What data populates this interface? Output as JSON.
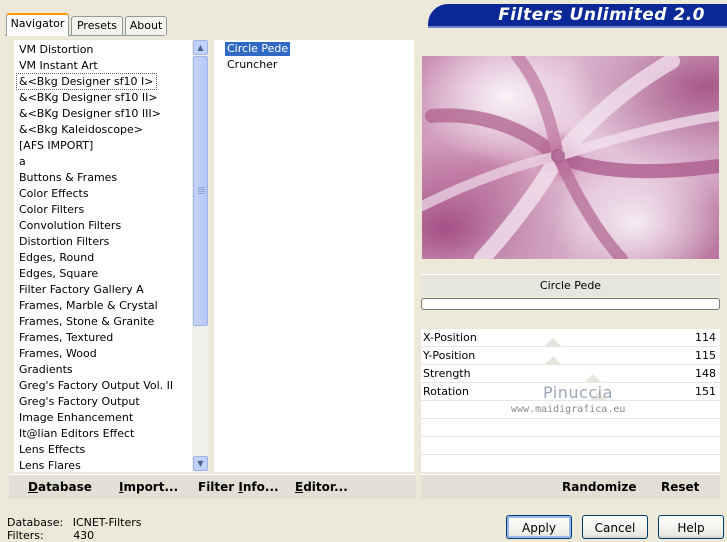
{
  "banner": {
    "title": "Filters Unlimited 2.0"
  },
  "tabs": [
    {
      "label": "Navigator"
    },
    {
      "label": "Presets"
    },
    {
      "label": "About"
    }
  ],
  "categories": [
    " VM Distortion",
    " VM Instant Art",
    "&<Bkg Designer sf10 I>",
    "&<BKg Designer sf10 II>",
    "&<BKg Designer sf10 III>",
    "&<Bkg Kaleidoscope>",
    "[AFS IMPORT]",
    "a",
    "Buttons & Frames",
    "Color Effects",
    "Color Filters",
    "Convolution Filters",
    "Distortion Filters",
    "Edges, Round",
    "Edges, Square",
    "Filter Factory Gallery A",
    "Frames, Marble & Crystal",
    "Frames, Stone & Granite",
    "Frames, Textured",
    "Frames, Wood",
    "Gradients",
    "Greg's Factory Output Vol. II",
    "Greg's Factory Output",
    "Image Enhancement",
    "It@lian Editors Effect",
    "Lens Effects",
    "Lens Flares"
  ],
  "filters": [
    "Circle Pede",
    "Cruncher"
  ],
  "selected_filter_name": "Circle Pede",
  "params": [
    {
      "label": "X-Position",
      "value": "114"
    },
    {
      "label": "Y-Position",
      "value": "115"
    },
    {
      "label": "Strength",
      "value": "148"
    },
    {
      "label": "Rotation",
      "value": "151"
    }
  ],
  "watermark": {
    "line1": "Pinuccia",
    "line2": "www.maidigrafica.eu"
  },
  "toolbar": {
    "database_u": "D",
    "database_rest": "atabase",
    "import_u": "I",
    "import_rest": "mport...",
    "filterinfo_pre": "Filter ",
    "filterinfo_u": "I",
    "filterinfo_rest": "nfo...",
    "editor_u": "E",
    "editor_rest": "ditor...",
    "randomize": "Randomize",
    "reset": "Reset"
  },
  "info": {
    "database_label": "Database:",
    "database_value": "ICNET-Filters",
    "filters_label": "Filters:",
    "filters_value": "430"
  },
  "buttons": {
    "apply": "Apply",
    "cancel": "Cancel",
    "help": "Help"
  }
}
